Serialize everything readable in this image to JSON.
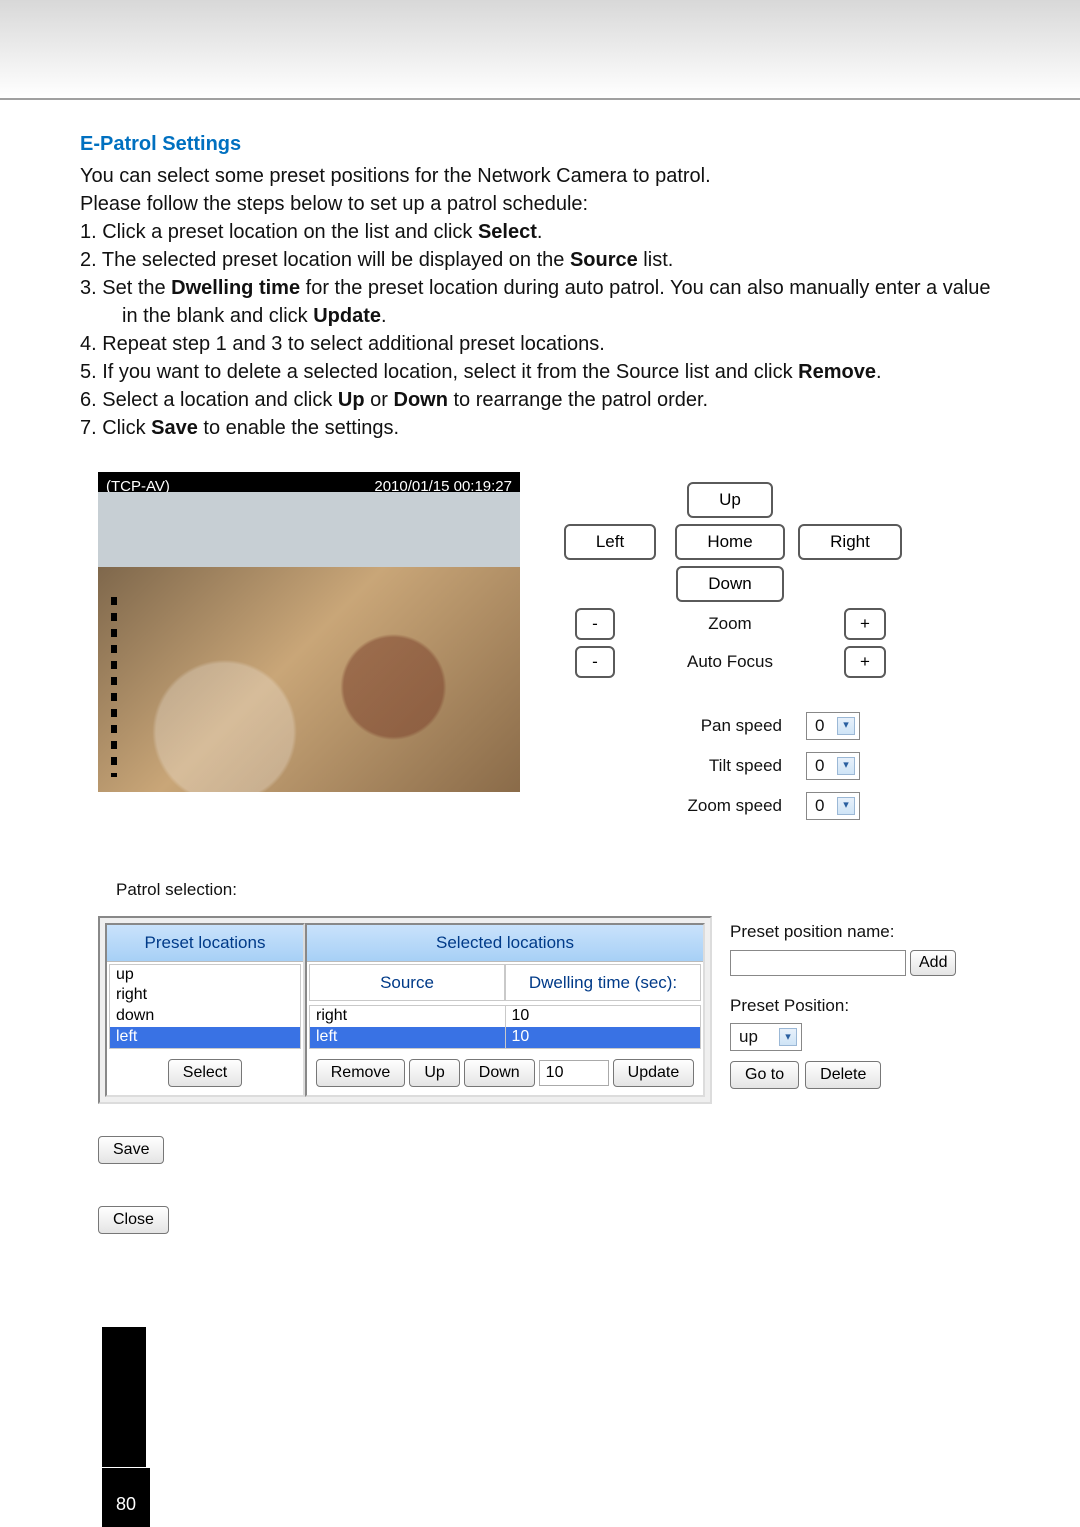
{
  "section": {
    "title": "E-Patrol Settings",
    "intro1": "You can select some preset positions for the Network Camera to patrol.",
    "intro2": "Please follow the steps below to set up a patrol schedule:",
    "s1": "1. Click a preset location on the list and click ",
    "s1b": "Select",
    "s1c": ".",
    "s2": "2. The selected preset location will be displayed on the ",
    "s2b": "Source",
    "s2c": " list.",
    "s3": "3. Set the ",
    "s3b": "Dwelling time",
    "s3c": " for the preset location during auto patrol. You can also manually enter a value",
    "s3d": "in the blank and click ",
    "s3e": "Update",
    "s3f": ".",
    "s4": "4. Repeat step 1 and 3 to select additional preset locations.",
    "s5": "5. If you want to delete a selected location, select it from the Source list and click ",
    "s5b": "Remove",
    "s5c": ".",
    "s6": "6. Select a location and click ",
    "s6b": "Up",
    "s6c": " or ",
    "s6d": "Down",
    "s6e": " to rearrange the patrol order.",
    "s7": "7. Click ",
    "s7b": "Save",
    "s7c": " to enable the settings."
  },
  "camera": {
    "label": "(TCP-AV)",
    "timestamp": "2010/01/15 00:19:27"
  },
  "ptz": {
    "up": "Up",
    "down": "Down",
    "left": "Left",
    "right": "Right",
    "home": "Home",
    "zoom": "Zoom",
    "autofocus": "Auto Focus",
    "minus": "-",
    "plus": "+",
    "panLabel": "Pan speed",
    "tiltLabel": "Tilt speed",
    "zoomLabel": "Zoom speed",
    "panVal": "0",
    "tiltVal": "0",
    "zoomVal": "0"
  },
  "patrol": {
    "label": "Patrol selection:",
    "presetHead": "Preset locations",
    "selectedHead": "Selected locations",
    "sourceHead": "Source",
    "dwellHead": "Dwelling time (sec):",
    "presets": {
      "i0": "up",
      "i1": "right",
      "i2": "down",
      "i3": "left"
    },
    "sources": {
      "i0": "right",
      "i1": "left"
    },
    "dwells": {
      "i0": "10",
      "i1": "10"
    },
    "dwellInput": "10",
    "select": "Select",
    "remove": "Remove",
    "up": "Up",
    "down": "Down",
    "update": "Update",
    "presetPosNameLabel": "Preset position name:",
    "presetPositionLabel": "Preset Position:",
    "presetPosValue": "up",
    "add": "Add",
    "goto": "Go to",
    "delete": "Delete",
    "save": "Save",
    "close": "Close"
  },
  "page": "80"
}
